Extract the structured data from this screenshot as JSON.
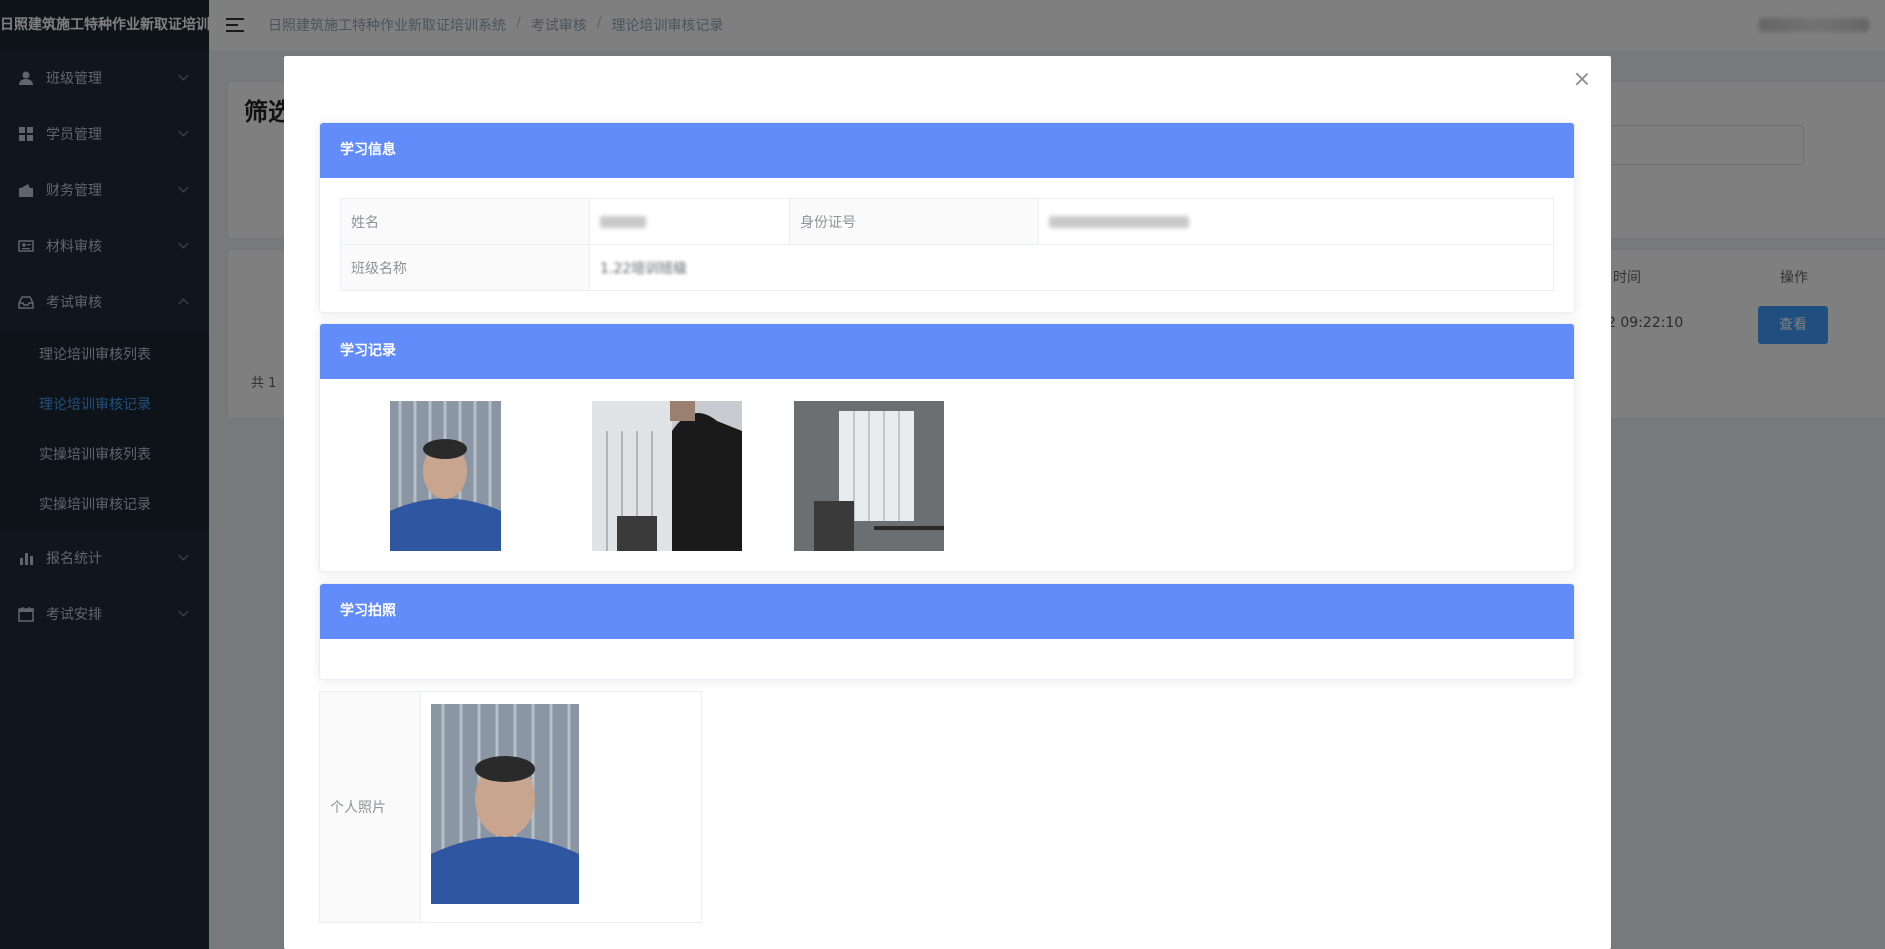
{
  "app": {
    "title": "日照建筑施工特种作业新取证培训系统"
  },
  "sidebar": {
    "logo": "日照建筑施工特种作业新取证培训",
    "items": [
      {
        "label": "班级管理",
        "icon": "user-icon"
      },
      {
        "label": "学员管理",
        "icon": "grid-icon"
      },
      {
        "label": "财务管理",
        "icon": "wallet-icon"
      },
      {
        "label": "材料审核",
        "icon": "id-card-icon"
      },
      {
        "label": "考试审核",
        "icon": "inbox-icon",
        "expanded": true
      },
      {
        "label": "报名统计",
        "icon": "bar-chart-icon"
      },
      {
        "label": "考试安排",
        "icon": "calendar-icon"
      }
    ],
    "submenu": [
      {
        "label": "理论培训审核列表"
      },
      {
        "label": "理论培训审核记录",
        "active": true
      },
      {
        "label": "实操培训审核列表"
      },
      {
        "label": "实操培训审核记录"
      }
    ]
  },
  "header": {
    "breadcrumb": [
      "日照建筑施工特种作业新取证培训系统",
      "考试审核",
      "理论培训审核记录"
    ],
    "separator": "/"
  },
  "background": {
    "filter_title": "筛选",
    "col_time": "时间",
    "col_action": "操作",
    "row_time": "2 09:22:10",
    "view_button": "查看",
    "total": "共 1"
  },
  "modal": {
    "study_info": {
      "title": "学习信息",
      "name_label": "姓名",
      "id_label": "身份证号",
      "class_label": "班级名称",
      "class_value": "1.22培训班级"
    },
    "study_record": {
      "title": "学习记录",
      "photos": [
        "face-photo",
        "room-person-photo",
        "room-window-photo"
      ]
    },
    "study_photo": {
      "title": "学习拍照",
      "personal_label": "个人照片"
    }
  },
  "colors": {
    "sidebar_bg": "#1f2d3d",
    "accent": "#409eff",
    "section_header": "#638cfb"
  }
}
